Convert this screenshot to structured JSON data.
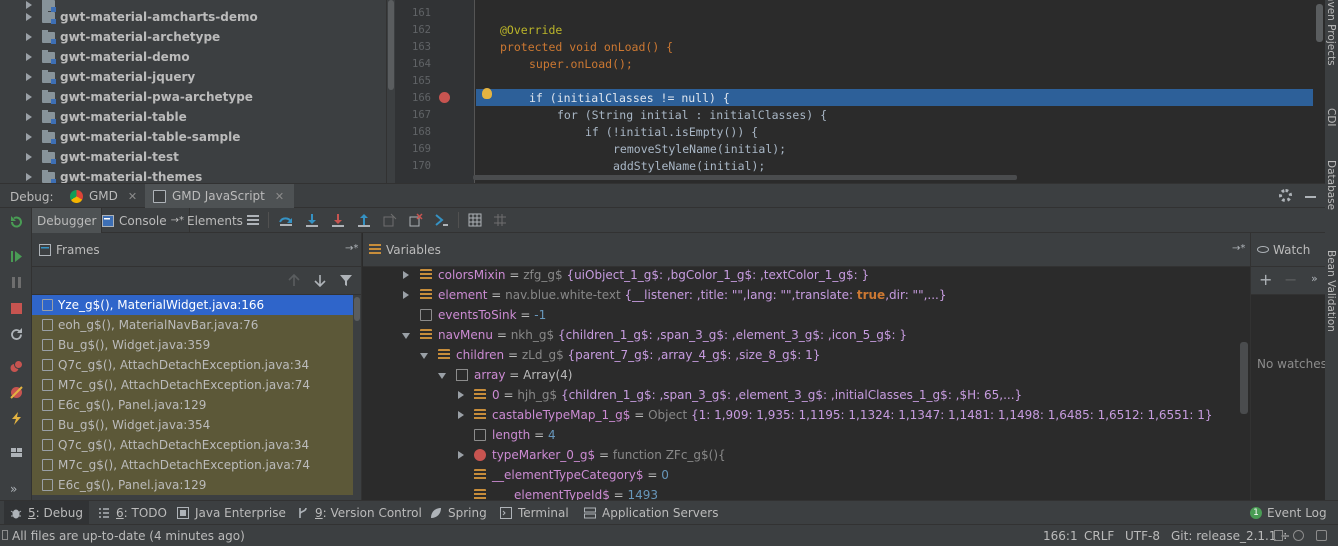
{
  "project_tree": {
    "items": [
      {
        "label": "gwt-material-amcharts-demo"
      },
      {
        "label": "gwt-material-archetype"
      },
      {
        "label": "gwt-material-demo"
      },
      {
        "label": "gwt-material-jquery"
      },
      {
        "label": "gwt-material-pwa-archetype"
      },
      {
        "label": "gwt-material-table"
      },
      {
        "label": "gwt-material-table-sample"
      },
      {
        "label": "gwt-material-test"
      },
      {
        "label": "gwt-material-themes"
      }
    ]
  },
  "editor": {
    "lines": [
      {
        "no": "161",
        "text": ""
      },
      {
        "no": "162",
        "text": "@Override"
      },
      {
        "no": "163",
        "text": "protected void onLoad() {"
      },
      {
        "no": "164",
        "text": "super.onLoad();"
      },
      {
        "no": "165",
        "text": ""
      },
      {
        "no": "166",
        "text": "if (initialClasses != null) {"
      },
      {
        "no": "167",
        "text": "for (String initial : initialClasses) {"
      },
      {
        "no": "168",
        "text": "if (!initial.isEmpty()) {"
      },
      {
        "no": "169",
        "text": "removeStyleName(initial);"
      },
      {
        "no": "170",
        "text": "addStyleName(initial);"
      }
    ],
    "highlighted_line": "166"
  },
  "right_strip": {
    "labels": [
      "Maven Projects",
      "CDI",
      "Database",
      "Bean Validation"
    ]
  },
  "debug": {
    "label": "Debug:",
    "tabs": [
      {
        "label": "GMD",
        "icon": "chrome-icon"
      },
      {
        "label": "GMD JavaScript",
        "icon": "javascript-icon"
      }
    ],
    "toolbar": {
      "debugger_label": "Debugger",
      "console_label": "Console",
      "console_suffix": "→*",
      "elements_label": "Elements"
    }
  },
  "frames": {
    "title": "Frames",
    "pin": "→*",
    "items": [
      {
        "label": "Yze_g$(), MaterialWidget.java:166",
        "selected": true
      },
      {
        "label": "eoh_g$(), MaterialNavBar.java:76"
      },
      {
        "label": "Bu_g$(), Widget.java:359"
      },
      {
        "label": "Q7c_g$(), AttachDetachException.java:34"
      },
      {
        "label": "M7c_g$(), AttachDetachException.java:74"
      },
      {
        "label": "E6c_g$(), Panel.java:129"
      },
      {
        "label": "Bu_g$(), Widget.java:354"
      },
      {
        "label": "Q7c_g$(), AttachDetachException.java:34"
      },
      {
        "label": "M7c_g$(), AttachDetachException.java:74"
      },
      {
        "label": "E6c_g$(), Panel.java:129"
      }
    ]
  },
  "variables": {
    "title": "Variables",
    "pin": "→*",
    "rows": [
      {
        "name": "colorsMixin",
        "eq": " = ",
        "type": "zfg_g$ ",
        "value": "{uiObject_1_g$: ,bgColor_1_g$: ,textColor_1_g$: }"
      },
      {
        "name": "element",
        "eq": " = ",
        "type": "nav.blue.white-text ",
        "value": "{__listener: ,title: \"\",lang: \"\",translate: ",
        "bool": "true",
        "value2": ",dir: \"\",...}"
      },
      {
        "name": "eventsToSink",
        "eq": " = ",
        "num": "-1"
      },
      {
        "name": "navMenu",
        "eq": " = ",
        "type": "nkh_g$ ",
        "value": "{children_1_g$: ,span_3_g$: ,element_3_g$: ,icon_5_g$: }"
      },
      {
        "name": "children",
        "eq": " = ",
        "type": "zLd_g$ ",
        "value": "{parent_7_g$: ,array_4_g$: ,size_8_g$: 1}"
      },
      {
        "name": "array",
        "eq": " = ",
        "plain_value": "Array(4)"
      },
      {
        "name": "0",
        "eq": " = ",
        "type": "hjh_g$ ",
        "value": "{children_1_g$: ,span_3_g$: ,element_3_g$: ,initialClasses_1_g$: ,$H: 65,...}"
      },
      {
        "name": "castableTypeMap_1_g$",
        "eq": " = ",
        "type": "Object ",
        "value": "{1: 1,909: 1,935: 1,1195: 1,1324: 1,1347: 1,1481: 1,1498: 1,6485: 1,6512: 1,6551: 1}"
      },
      {
        "name": "length",
        "eq": " = ",
        "num": "4"
      },
      {
        "name": "typeMarker_0_g$",
        "eq": " = ",
        "type": "function ZFc_g$(){"
      },
      {
        "name": "__elementTypeCategory$",
        "eq": " = ",
        "num": "0"
      },
      {
        "name": "__elementTypeId$",
        "eq": " = ",
        "num": "1493"
      }
    ]
  },
  "watches": {
    "title": "Watch",
    "empty_text": "No watches",
    "pin": "→*"
  },
  "bottom_tabs": [
    {
      "key": "5",
      "label": ": Debug"
    },
    {
      "key": "6",
      "label": ": TODO"
    },
    {
      "key": "",
      "label": "Java Enterprise"
    },
    {
      "key": "9",
      "label": ": Version Control"
    },
    {
      "key": "",
      "label": "Spring"
    },
    {
      "key": "",
      "label": "Terminal"
    },
    {
      "key": "",
      "label": "Application Servers"
    }
  ],
  "event_log": {
    "badge": "1",
    "label": "Event Log"
  },
  "status": {
    "message": "All files are up-to-date (4 minutes ago)",
    "position": "166:1",
    "line_sep": "CRLF",
    "encoding": "UTF-8",
    "git": "Git: release_2.1.1 ÷"
  },
  "colors": {
    "accent_selection": "#2f65ca",
    "highlight_line": "#2d6099",
    "breakpoint": "#c75450"
  }
}
